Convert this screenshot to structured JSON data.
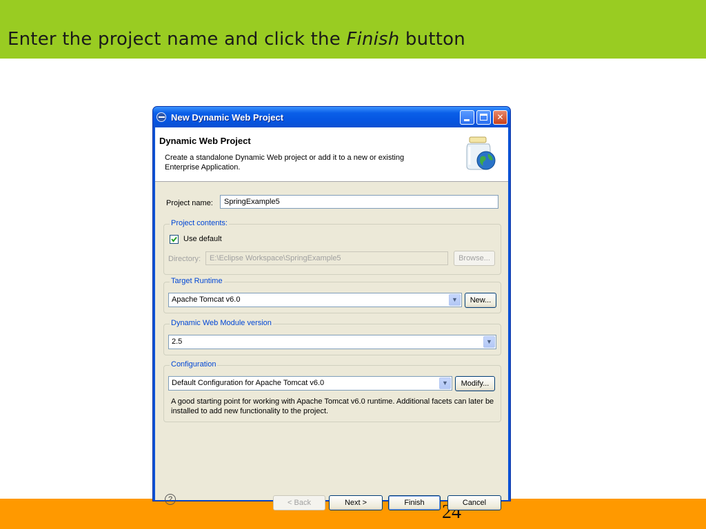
{
  "slide": {
    "title_part1": "Enter the project name and click the ",
    "title_italic": "Finish",
    "title_part2": " button",
    "page_number": "24",
    "header_color": "#99cc22",
    "footer_color": "#ff9900"
  },
  "window": {
    "title": "New Dynamic Web Project",
    "controls": {
      "minimize": "minimize",
      "maximize": "maximize",
      "close": "✕"
    }
  },
  "banner": {
    "title": "Dynamic Web Project",
    "description": "Create a standalone Dynamic Web project or add it to a new or existing Enterprise Application.",
    "icon": "jar-globe-icon"
  },
  "project_name": {
    "label": "Project name:",
    "value": "SpringExample5"
  },
  "project_contents": {
    "group_label": "Project contents:",
    "use_default_label": "Use default",
    "use_default_checked": true,
    "directory_label": "Directory:",
    "directory_value": "E:\\Eclipse Workspace\\SpringExample5",
    "browse_label": "Browse..."
  },
  "target_runtime": {
    "group_label": "Target Runtime",
    "selected": "Apache Tomcat v6.0",
    "new_label": "New..."
  },
  "module_version": {
    "group_label": "Dynamic Web Module version",
    "selected": "2.5"
  },
  "configuration": {
    "group_label": "Configuration",
    "selected": "Default Configuration for Apache Tomcat v6.0",
    "modify_label": "Modify...",
    "description": "A good starting point for working with Apache Tomcat v6.0 runtime. Additional facets can later be installed to add new functionality to the project."
  },
  "footer": {
    "help_icon": "?",
    "back_label": "< Back",
    "next_label": "Next >",
    "finish_label": "Finish",
    "cancel_label": "Cancel"
  }
}
